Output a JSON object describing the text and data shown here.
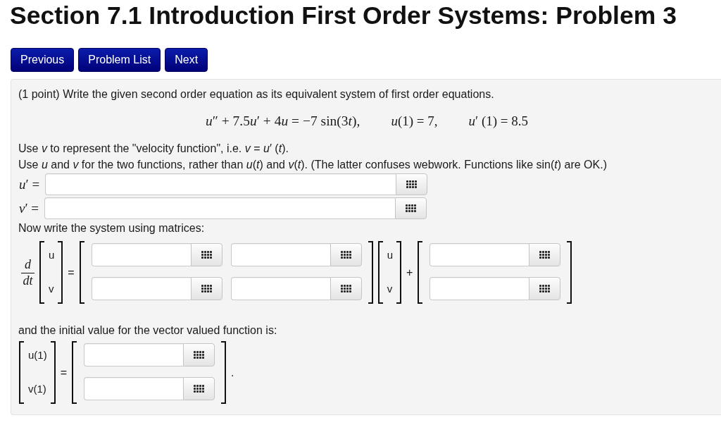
{
  "title": "Section 7.1 Introduction First Order Systems: Problem 3",
  "nav_buttons": [
    "Previous",
    "Problem List",
    "Next"
  ],
  "problem": {
    "intro": "(1 point) Write the given second order equation as its equivalent system of first order equations.",
    "equations": [
      {
        "segments": [
          {
            "text": "u",
            "italic": true
          },
          {
            "text": "″ + 7.5",
            "italic": false
          },
          {
            "text": "u",
            "italic": true
          },
          {
            "text": "′ + 4",
            "italic": false
          },
          {
            "text": "u",
            "italic": true
          },
          {
            "text": " = −7 sin(3",
            "italic": false
          },
          {
            "text": "t",
            "italic": true
          },
          {
            "text": "),",
            "italic": false
          }
        ]
      },
      {
        "segments": [
          {
            "text": "u",
            "italic": true
          },
          {
            "text": "(1) = 7,",
            "italic": false
          }
        ]
      },
      {
        "segments": [
          {
            "text": "u",
            "italic": true
          },
          {
            "text": "′ (1) = 8.5",
            "italic": false
          }
        ]
      }
    ],
    "instructions": [
      "Use *v* to represent the \"velocity function\", i.e. *v* = *u*′ (*t*).",
      "Use *u* and *v* for the two functions, rather than *u*(*t*) and *v*(*t*). (The latter confuses webwork. Functions like sin(*t*) are OK.)"
    ],
    "answer_rows": [
      {
        "label": "*u*′ ="
      },
      {
        "label": "*v*′ ="
      }
    ],
    "matrix_prompt": "Now write the system using matrices:",
    "matrix_equation": [
      {
        "kind": "fraction",
        "numerator": "d",
        "denominator": "dt"
      },
      {
        "kind": "matrix",
        "rows": [
          {
            "cells": [
              {
                "kind": "text",
                "text": "u"
              }
            ]
          },
          {
            "cells": [
              {
                "kind": "text",
                "text": "v"
              }
            ]
          }
        ]
      },
      {
        "kind": "symbol",
        "text": "="
      },
      {
        "kind": "matrix",
        "rows": [
          {
            "cells": [
              {
                "kind": "answer"
              },
              {
                "kind": "answer"
              }
            ]
          },
          {
            "cells": [
              {
                "kind": "answer"
              },
              {
                "kind": "answer"
              }
            ]
          }
        ]
      },
      {
        "kind": "matrix",
        "rows": [
          {
            "cells": [
              {
                "kind": "text",
                "text": "u"
              }
            ]
          },
          {
            "cells": [
              {
                "kind": "text",
                "text": "v"
              }
            ]
          }
        ]
      },
      {
        "kind": "symbol",
        "text": "+"
      },
      {
        "kind": "matrix",
        "rows": [
          {
            "cells": [
              {
                "kind": "answer"
              }
            ]
          },
          {
            "cells": [
              {
                "kind": "answer"
              }
            ]
          }
        ]
      }
    ],
    "initial_prompt": "and the initial value for the vector valued function is:",
    "initial_equation": [
      {
        "kind": "matrix",
        "rows": [
          {
            "cells": [
              {
                "kind": "text",
                "text": "u(1)"
              }
            ]
          },
          {
            "cells": [
              {
                "kind": "text",
                "text": "v(1)"
              }
            ]
          }
        ]
      },
      {
        "kind": "symbol",
        "text": "="
      },
      {
        "kind": "matrix",
        "rows": [
          {
            "cells": [
              {
                "kind": "answer"
              }
            ]
          },
          {
            "cells": [
              {
                "kind": "answer"
              }
            ]
          }
        ]
      },
      {
        "kind": "symbol",
        "text": "."
      }
    ]
  }
}
